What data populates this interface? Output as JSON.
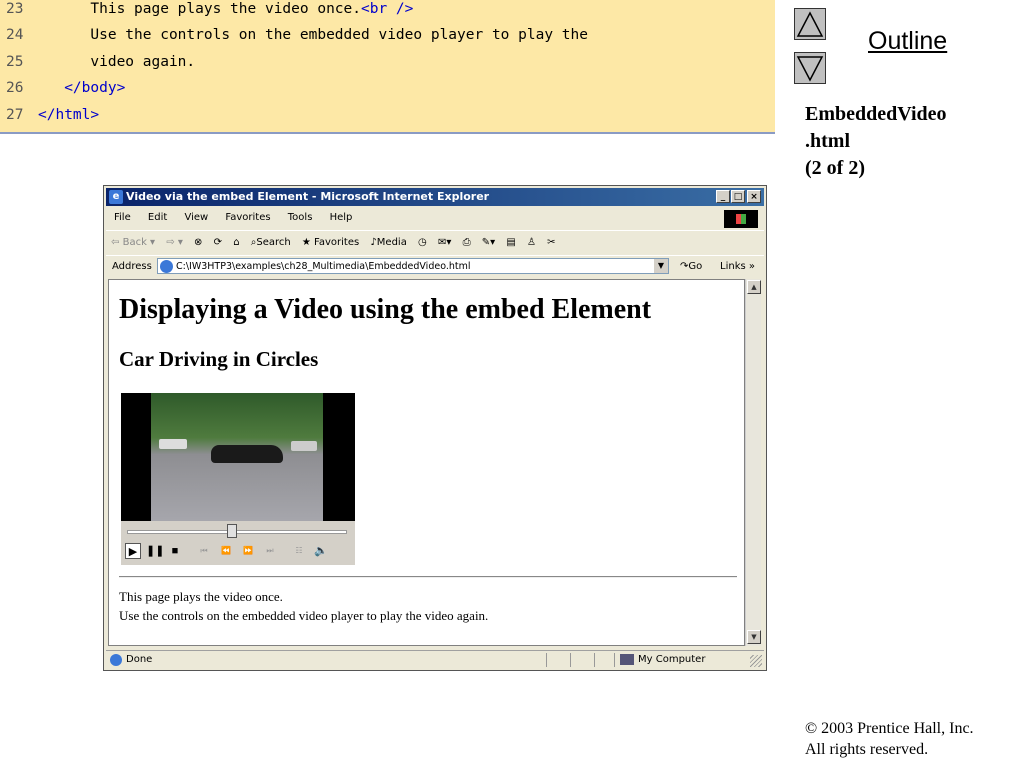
{
  "code": {
    "lines": [
      {
        "num": "23",
        "parts": [
          {
            "text": "      This page plays the video once.",
            "tag": false
          },
          {
            "text": "<br />",
            "tag": true
          }
        ]
      },
      {
        "num": "24",
        "parts": [
          {
            "text": "      Use the controls on the embedded video player to play the",
            "tag": false
          }
        ]
      },
      {
        "num": "25",
        "parts": [
          {
            "text": "      video again.",
            "tag": false
          }
        ]
      },
      {
        "num": "26",
        "parts": [
          {
            "text": "   ",
            "tag": false
          },
          {
            "text": "</body>",
            "tag": true
          }
        ]
      },
      {
        "num": "27",
        "parts": [
          {
            "text": "",
            "tag": false
          },
          {
            "text": "</html>",
            "tag": true
          }
        ]
      }
    ]
  },
  "sidebar": {
    "outline_label": "Outline",
    "file_line1": "EmbeddedVideo",
    "file_line2": ".html",
    "file_line3": "(2 of 2)",
    "copyright_line1": "© 2003 Prentice Hall, Inc.",
    "copyright_line2": "All rights reserved."
  },
  "browser": {
    "title": "Video via the embed Element - Microsoft Internet Explorer",
    "menu": [
      "File",
      "Edit",
      "View",
      "Favorites",
      "Tools",
      "Help"
    ],
    "toolbar": {
      "back": "Back",
      "search": "Search",
      "favorites": "Favorites",
      "media": "Media"
    },
    "address_label": "Address",
    "address_value": "C:\\IW3HTP3\\examples\\ch28_Multimedia\\EmbeddedVideo.html",
    "go_label": "Go",
    "links_label": "Links",
    "status_text": "Done",
    "zone_text": "My Computer"
  },
  "page": {
    "h1": "Displaying a Video using the embed Element",
    "h2": "Car Driving in Circles",
    "para_line1": "This page plays the video once.",
    "para_line2": "Use the controls on the embedded video player to play the video again."
  },
  "player": {
    "progress": 0.5
  }
}
